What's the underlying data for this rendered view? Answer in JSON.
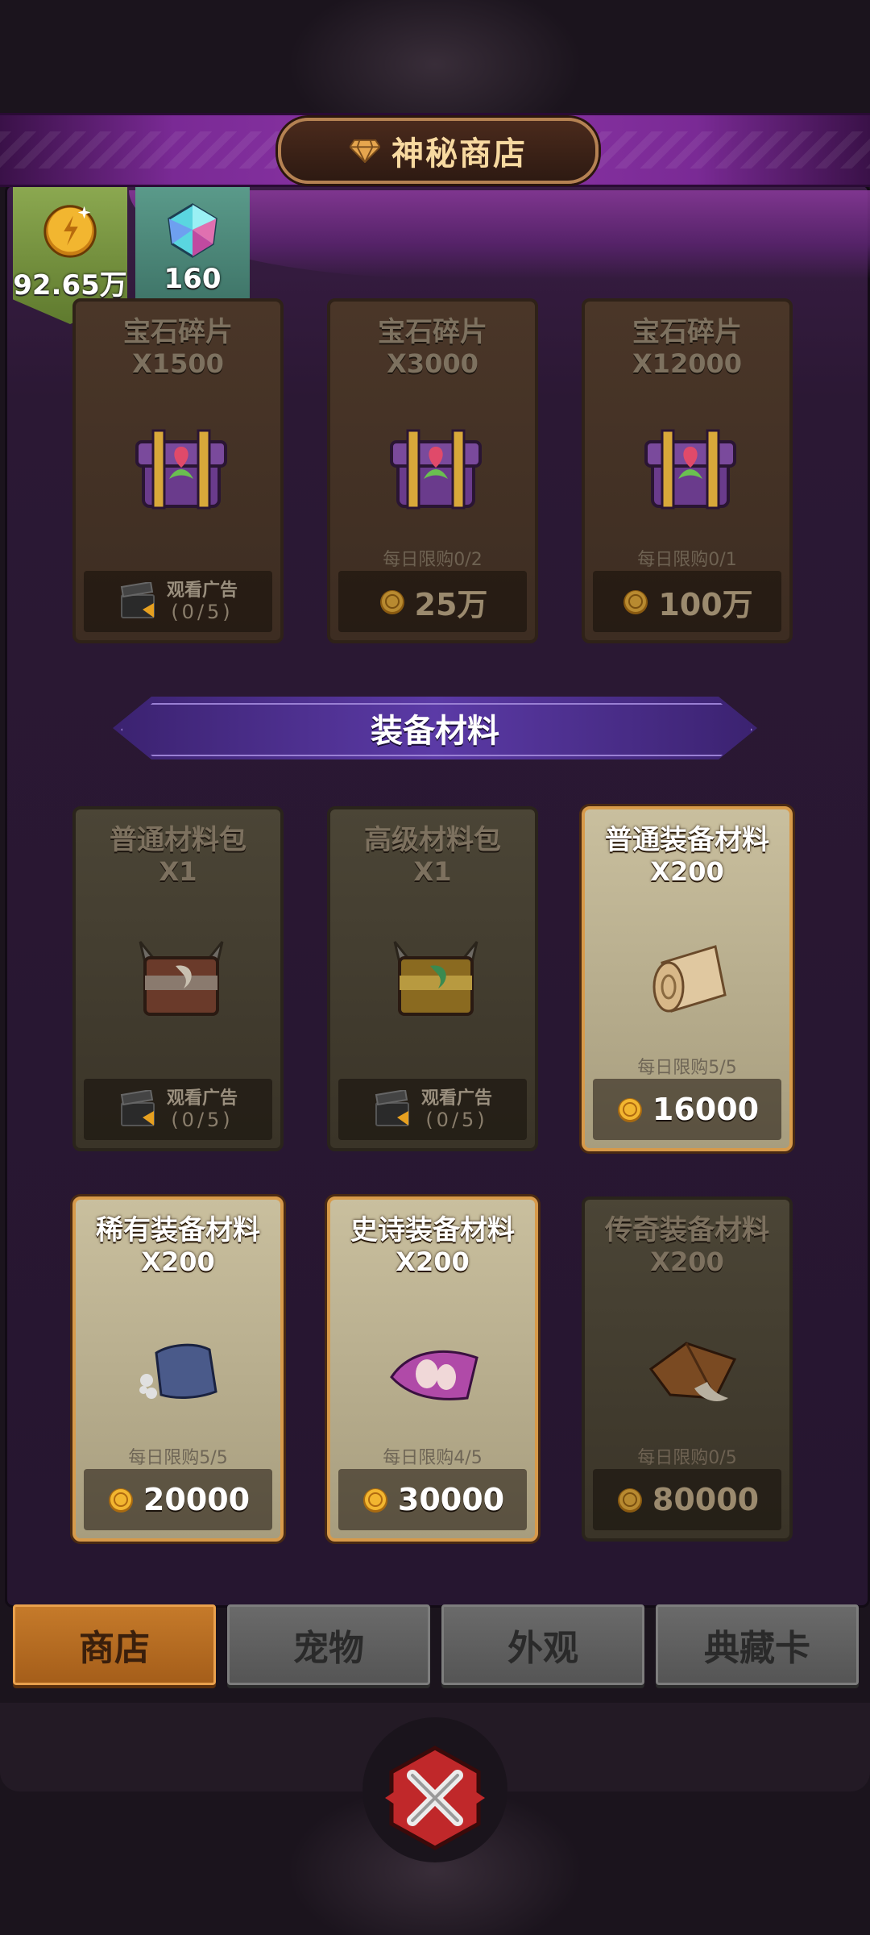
{
  "header": {
    "title": "神秘商店"
  },
  "currencies": {
    "coins": "92.65万",
    "gems": "160"
  },
  "top_items": [
    {
      "name": "宝石碎片",
      "qty": "X1500",
      "price_type": "ad",
      "ad_label": "观看广告",
      "ad_count": "(0/5)"
    },
    {
      "name": "宝石碎片",
      "qty": "X3000",
      "limit": "每日限购0/2",
      "price": "25万"
    },
    {
      "name": "宝石碎片",
      "qty": "X12000",
      "limit": "每日限购0/1",
      "price": "100万"
    }
  ],
  "section": {
    "title": "装备材料"
  },
  "materials": [
    {
      "name": "普通材料包",
      "qty": "X1",
      "ad_label": "观看广告",
      "ad_count": "(0/5)"
    },
    {
      "name": "高级材料包",
      "qty": "X1",
      "ad_label": "观看广告",
      "ad_count": "(0/5)"
    },
    {
      "name": "普通装备材料",
      "qty": "X200",
      "limit": "每日限购5/5",
      "price": "16000"
    },
    {
      "name": "稀有装备材料",
      "qty": "X200",
      "limit": "每日限购5/5",
      "price": "20000"
    },
    {
      "name": "史诗装备材料",
      "qty": "X200",
      "limit": "每日限购4/5",
      "price": "30000"
    },
    {
      "name": "传奇装备材料",
      "qty": "X200",
      "limit": "每日限购0/5",
      "price": "80000"
    }
  ],
  "tabs": [
    "商店",
    "宠物",
    "外观",
    "典藏卡"
  ],
  "icons": {
    "header": "diamond-icon",
    "coin": "gold-coin-icon",
    "gem": "gem-icon",
    "ad": "clapperboard-icon",
    "close": "close-x-icon"
  },
  "colors": {
    "active_tab": "#c57a2a",
    "card_border_bright": "#d79a4a",
    "banner": "#8d36a8"
  }
}
